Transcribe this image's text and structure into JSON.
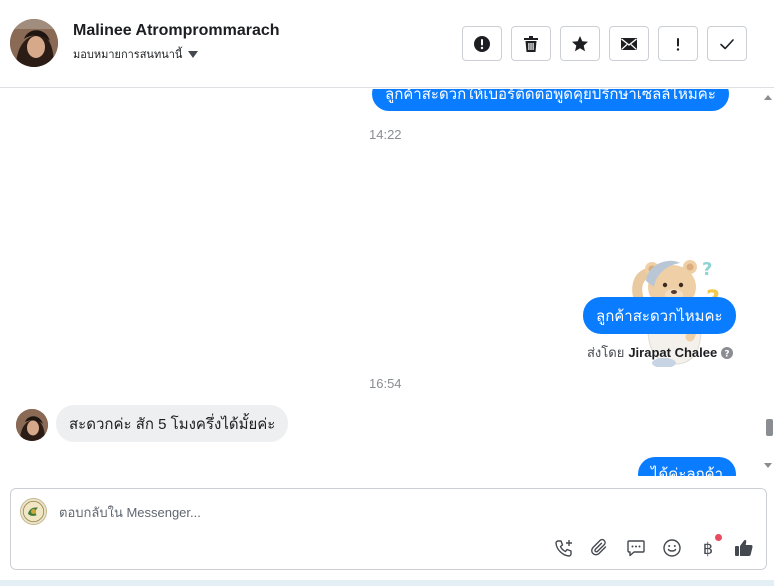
{
  "header": {
    "contact_name": "Malinee Atromprommarach",
    "assign_label": "มอบหมายการสนทนานี้",
    "actions": [
      {
        "name": "alert-button",
        "icon": "alert-circle-icon"
      },
      {
        "name": "delete-button",
        "icon": "trash-icon"
      },
      {
        "name": "star-button",
        "icon": "star-icon"
      },
      {
        "name": "mark-unread-button",
        "icon": "envelope-icon"
      },
      {
        "name": "spam-button",
        "icon": "exclamation-icon"
      },
      {
        "name": "done-button",
        "icon": "check-icon"
      }
    ]
  },
  "messages": {
    "top_partial": "ลูกค้าสะดวกให้เบอร์ติดต่อพูดคุยปรึกษาเซลล์ไหมคะ",
    "time_1": "14:22",
    "sticker": "teddy-bear-thinking-sticker",
    "msg_convenient": "ลูกค้าสะดวกไหมคะ",
    "sent_by_prefix": "ส่งโดย",
    "sent_by_name": "Jirapat Chalee",
    "time_2": "16:54",
    "incoming_reply": "สะดวกค่ะ สัก 5 โมงครึ่งได้มั้ยค่ะ",
    "bottom_partial": "ได้ค่ะลูกค้า"
  },
  "composer": {
    "placeholder": "ตอบกลับใน Messenger...",
    "tools": [
      "phone-add-icon",
      "paperclip-icon",
      "chat-bubble-icon",
      "emoji-icon",
      "baht-icon",
      "thumbs-up-icon"
    ],
    "baht_symbol": "฿"
  },
  "colors": {
    "accent": "#0a7cff",
    "incoming_bubble": "#eeeff1",
    "notification_dot": "#e84a5f"
  }
}
